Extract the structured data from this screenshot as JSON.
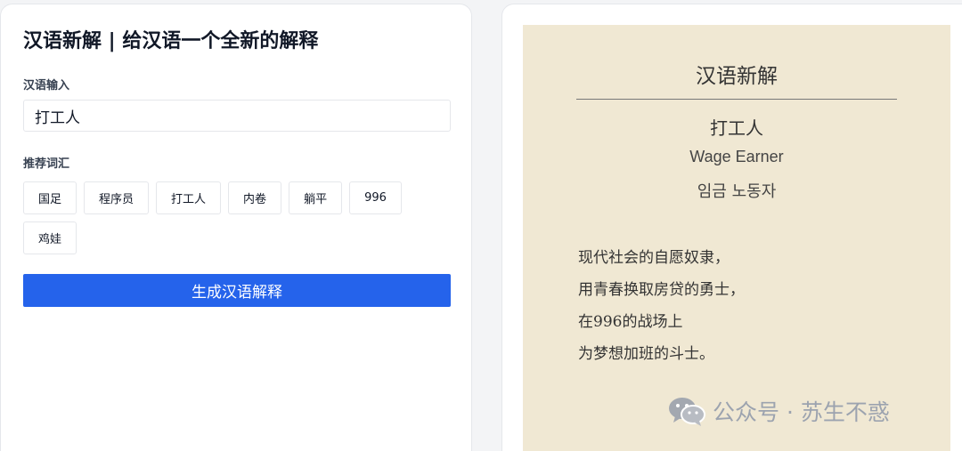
{
  "app": {
    "title": "汉语新解 | 给汉语一个全新的解释"
  },
  "form": {
    "input_label": "汉语输入",
    "input_value": "打工人",
    "suggest_label": "推荐词汇",
    "suggestions": [
      "国足",
      "程序员",
      "打工人",
      "内卷",
      "躺平",
      "996",
      "鸡娃"
    ],
    "generate_label": "生成汉语解释"
  },
  "card": {
    "title": "汉语新解",
    "word": "打工人",
    "english": "Wage Earner",
    "korean": "임금 노동자",
    "poem": [
      "现代社会的自愿奴隶，",
      "用青春换取房贷的勇士，",
      "在996的战场上",
      "为梦想加班的斗士。"
    ],
    "background_color": "#f0e8d3"
  },
  "watermark": {
    "icon": "wechat-icon",
    "text": "公众号 · 苏生不惑"
  },
  "colors": {
    "accent": "#2563eb"
  }
}
